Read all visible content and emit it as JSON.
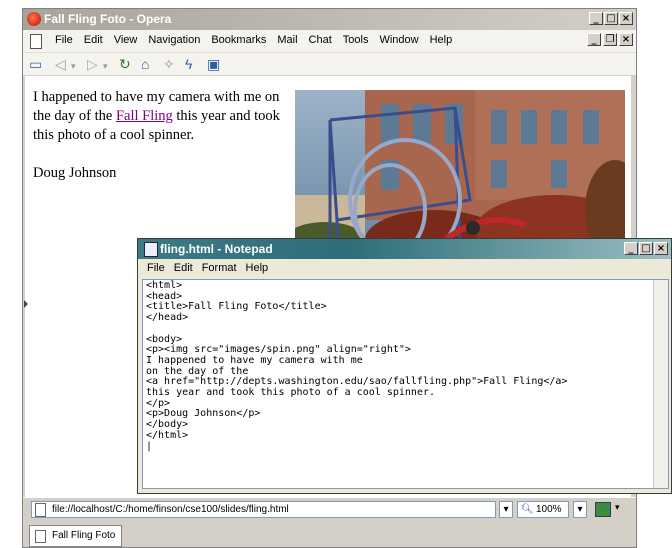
{
  "opera": {
    "title": "Fall Fling Foto - Opera",
    "menu": [
      "File",
      "Edit",
      "View",
      "Navigation",
      "Bookmarks",
      "Mail",
      "Chat",
      "Tools",
      "Window",
      "Help"
    ],
    "page": {
      "para_before_link": "I happened to have my camera with me on the day of the ",
      "link_text": "Fall Fling",
      "para_after_link": " this year and took this photo of a cool spinner.",
      "signature": "Doug Johnson"
    },
    "status": {
      "address": "file://localhost/C:/home/finson/cse100/slides/fling.html",
      "zoom": "100%"
    },
    "tab_label": "Fall Fling Foto"
  },
  "notepad": {
    "title": "fling.html - Notepad",
    "menu": [
      "File",
      "Edit",
      "Format",
      "Help"
    ],
    "content": "<html>\n<head>\n<title>Fall Fling Foto</title>\n</head>\n\n<body>\n<p><img src=\"images/spin.png\" align=\"right\">\nI happened to have my camera with me\non the day of the\n<a href=\"http://depts.washington.edu/sao/fallfling.php\">Fall Fling</a>\nthis year and took this photo of a cool spinner.\n</p>\n<p>Doug Johnson</p>\n</body>\n</html>\n|"
  },
  "colors": {
    "link_visited": "#800080",
    "notepad_title": "#2e6e78"
  },
  "icons": {
    "toolbar": [
      "open-folder-icon",
      "back-icon",
      "forward-icon",
      "reload-icon",
      "home-icon",
      "wand-icon",
      "lightning-icon",
      "monitor-icon"
    ]
  }
}
